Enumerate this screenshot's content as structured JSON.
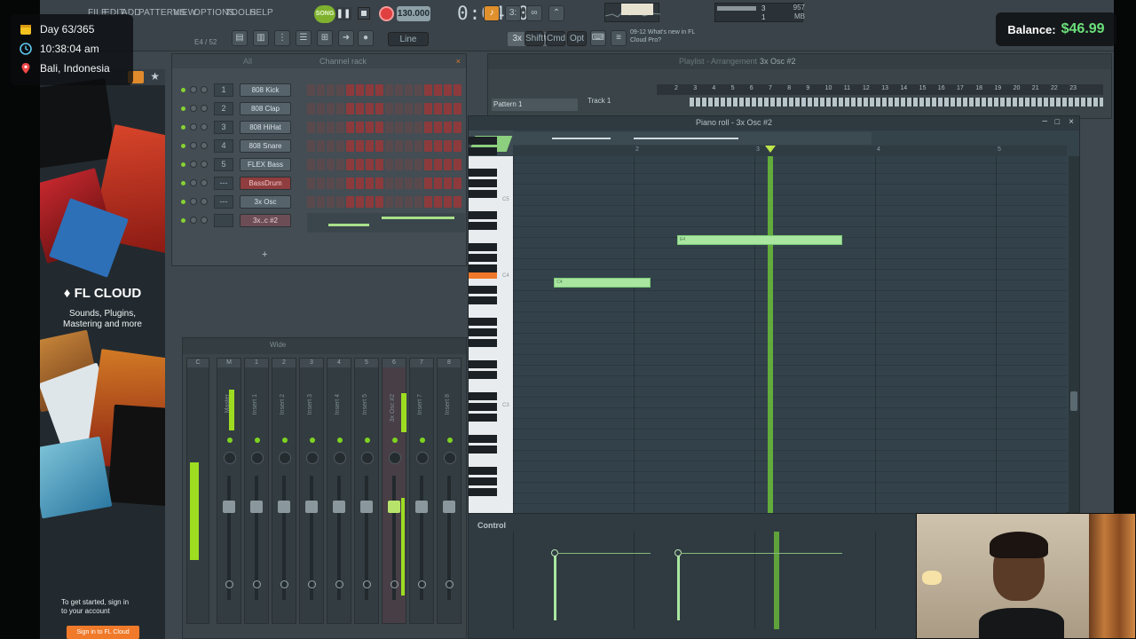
{
  "overlay": {
    "day": "Day 63/365",
    "time": "10:38:04 am",
    "location": "Bali, Indonesia",
    "balance_label": "Balance:",
    "balance_value": "$46.99"
  },
  "toolbar": {
    "menu": [
      "FILE",
      "EDIT",
      "ADD",
      "PATTERNS",
      "VIEW",
      "OPTIONS",
      "TOOLS",
      "HELP"
    ],
    "song_mode": "SONG",
    "tempo": "130.000",
    "song_time": "0:04:00",
    "position": "E4 / 52",
    "snap": "Line",
    "pattern": "3x Osc #2",
    "buttons": [
      "Shift",
      "Cmd",
      "Opt"
    ],
    "news_line1": "09-12  What's new in FL",
    "news_line2": "Cloud Pro?",
    "memory": "957 MB",
    "cpu_value": "3",
    "poly_value": "1"
  },
  "browser": {
    "cloud_title": "FL CLOUD",
    "cloud_sub_line1": "Sounds, Plugins,",
    "cloud_sub_line2": "Mastering and more",
    "signin_line1": "To get started, sign in",
    "signin_line2": "to your account",
    "signin_button": "Sign in to FL Cloud"
  },
  "channel_rack": {
    "title": "Channel rack",
    "filter": "All",
    "channels": [
      {
        "num": "1",
        "name": "808 Kick",
        "style": "normal"
      },
      {
        "num": "2",
        "name": "808 Clap",
        "style": "normal"
      },
      {
        "num": "3",
        "name": "808 HiHat",
        "style": "normal"
      },
      {
        "num": "4",
        "name": "808 Snare",
        "style": "normal"
      },
      {
        "num": "5",
        "name": "FLEX Bass",
        "style": "normal"
      },
      {
        "num": "---",
        "name": "BassDrum",
        "style": "red"
      },
      {
        "num": "---",
        "name": "3x Osc",
        "style": "normal"
      },
      {
        "num": "",
        "name": "3x..c #2",
        "style": "sel"
      }
    ],
    "add": "+"
  },
  "mixer": {
    "preset": "Wide",
    "strips": [
      {
        "num": "C",
        "label": ""
      },
      {
        "num": "M",
        "label": "Master"
      },
      {
        "num": "1",
        "label": "Insert 1"
      },
      {
        "num": "2",
        "label": "Insert 2"
      },
      {
        "num": "3",
        "label": "Insert 3"
      },
      {
        "num": "4",
        "label": "Insert 4"
      },
      {
        "num": "5",
        "label": "Insert 5"
      },
      {
        "num": "6",
        "label": "3x Osc #2"
      },
      {
        "num": "7",
        "label": "Insert 7"
      },
      {
        "num": "8",
        "label": "Insert 8"
      }
    ],
    "selected_index": 7
  },
  "playlist": {
    "title": "Playlist - Arrangement",
    "pattern_label": "3x Osc #2",
    "pattern_item": "Pattern 1",
    "track": "Track 1",
    "ruler": [
      "2",
      "3",
      "4",
      "5",
      "6",
      "7",
      "8",
      "9",
      "10",
      "11",
      "12",
      "13",
      "14",
      "15",
      "16",
      "17",
      "18",
      "19",
      "20",
      "21",
      "22",
      "23"
    ]
  },
  "piano_roll": {
    "title": "Piano roll - 3x Osc #2",
    "ruler": [
      "2",
      "3",
      "4",
      "5"
    ],
    "notes": [
      {
        "label": "E4",
        "start_bar": 2.36,
        "end_bar": 3.73,
        "pitch": "E4"
      },
      {
        "label": "C4",
        "start_bar": 1.34,
        "end_bar": 2.14,
        "pitch": "C4"
      }
    ],
    "playhead_bar": 3.13,
    "highlighted_key": "C4",
    "octave_labels": [
      "C5",
      "C4",
      "C3"
    ]
  },
  "control_lane": {
    "label": "Control",
    "velocities": [
      1.0,
      1.0
    ]
  },
  "colors": {
    "accent_green": "#a9e6a0",
    "playhead": "#6bbd3a",
    "highlight_key": "#f0782a",
    "balance_green": "#6be07a"
  }
}
